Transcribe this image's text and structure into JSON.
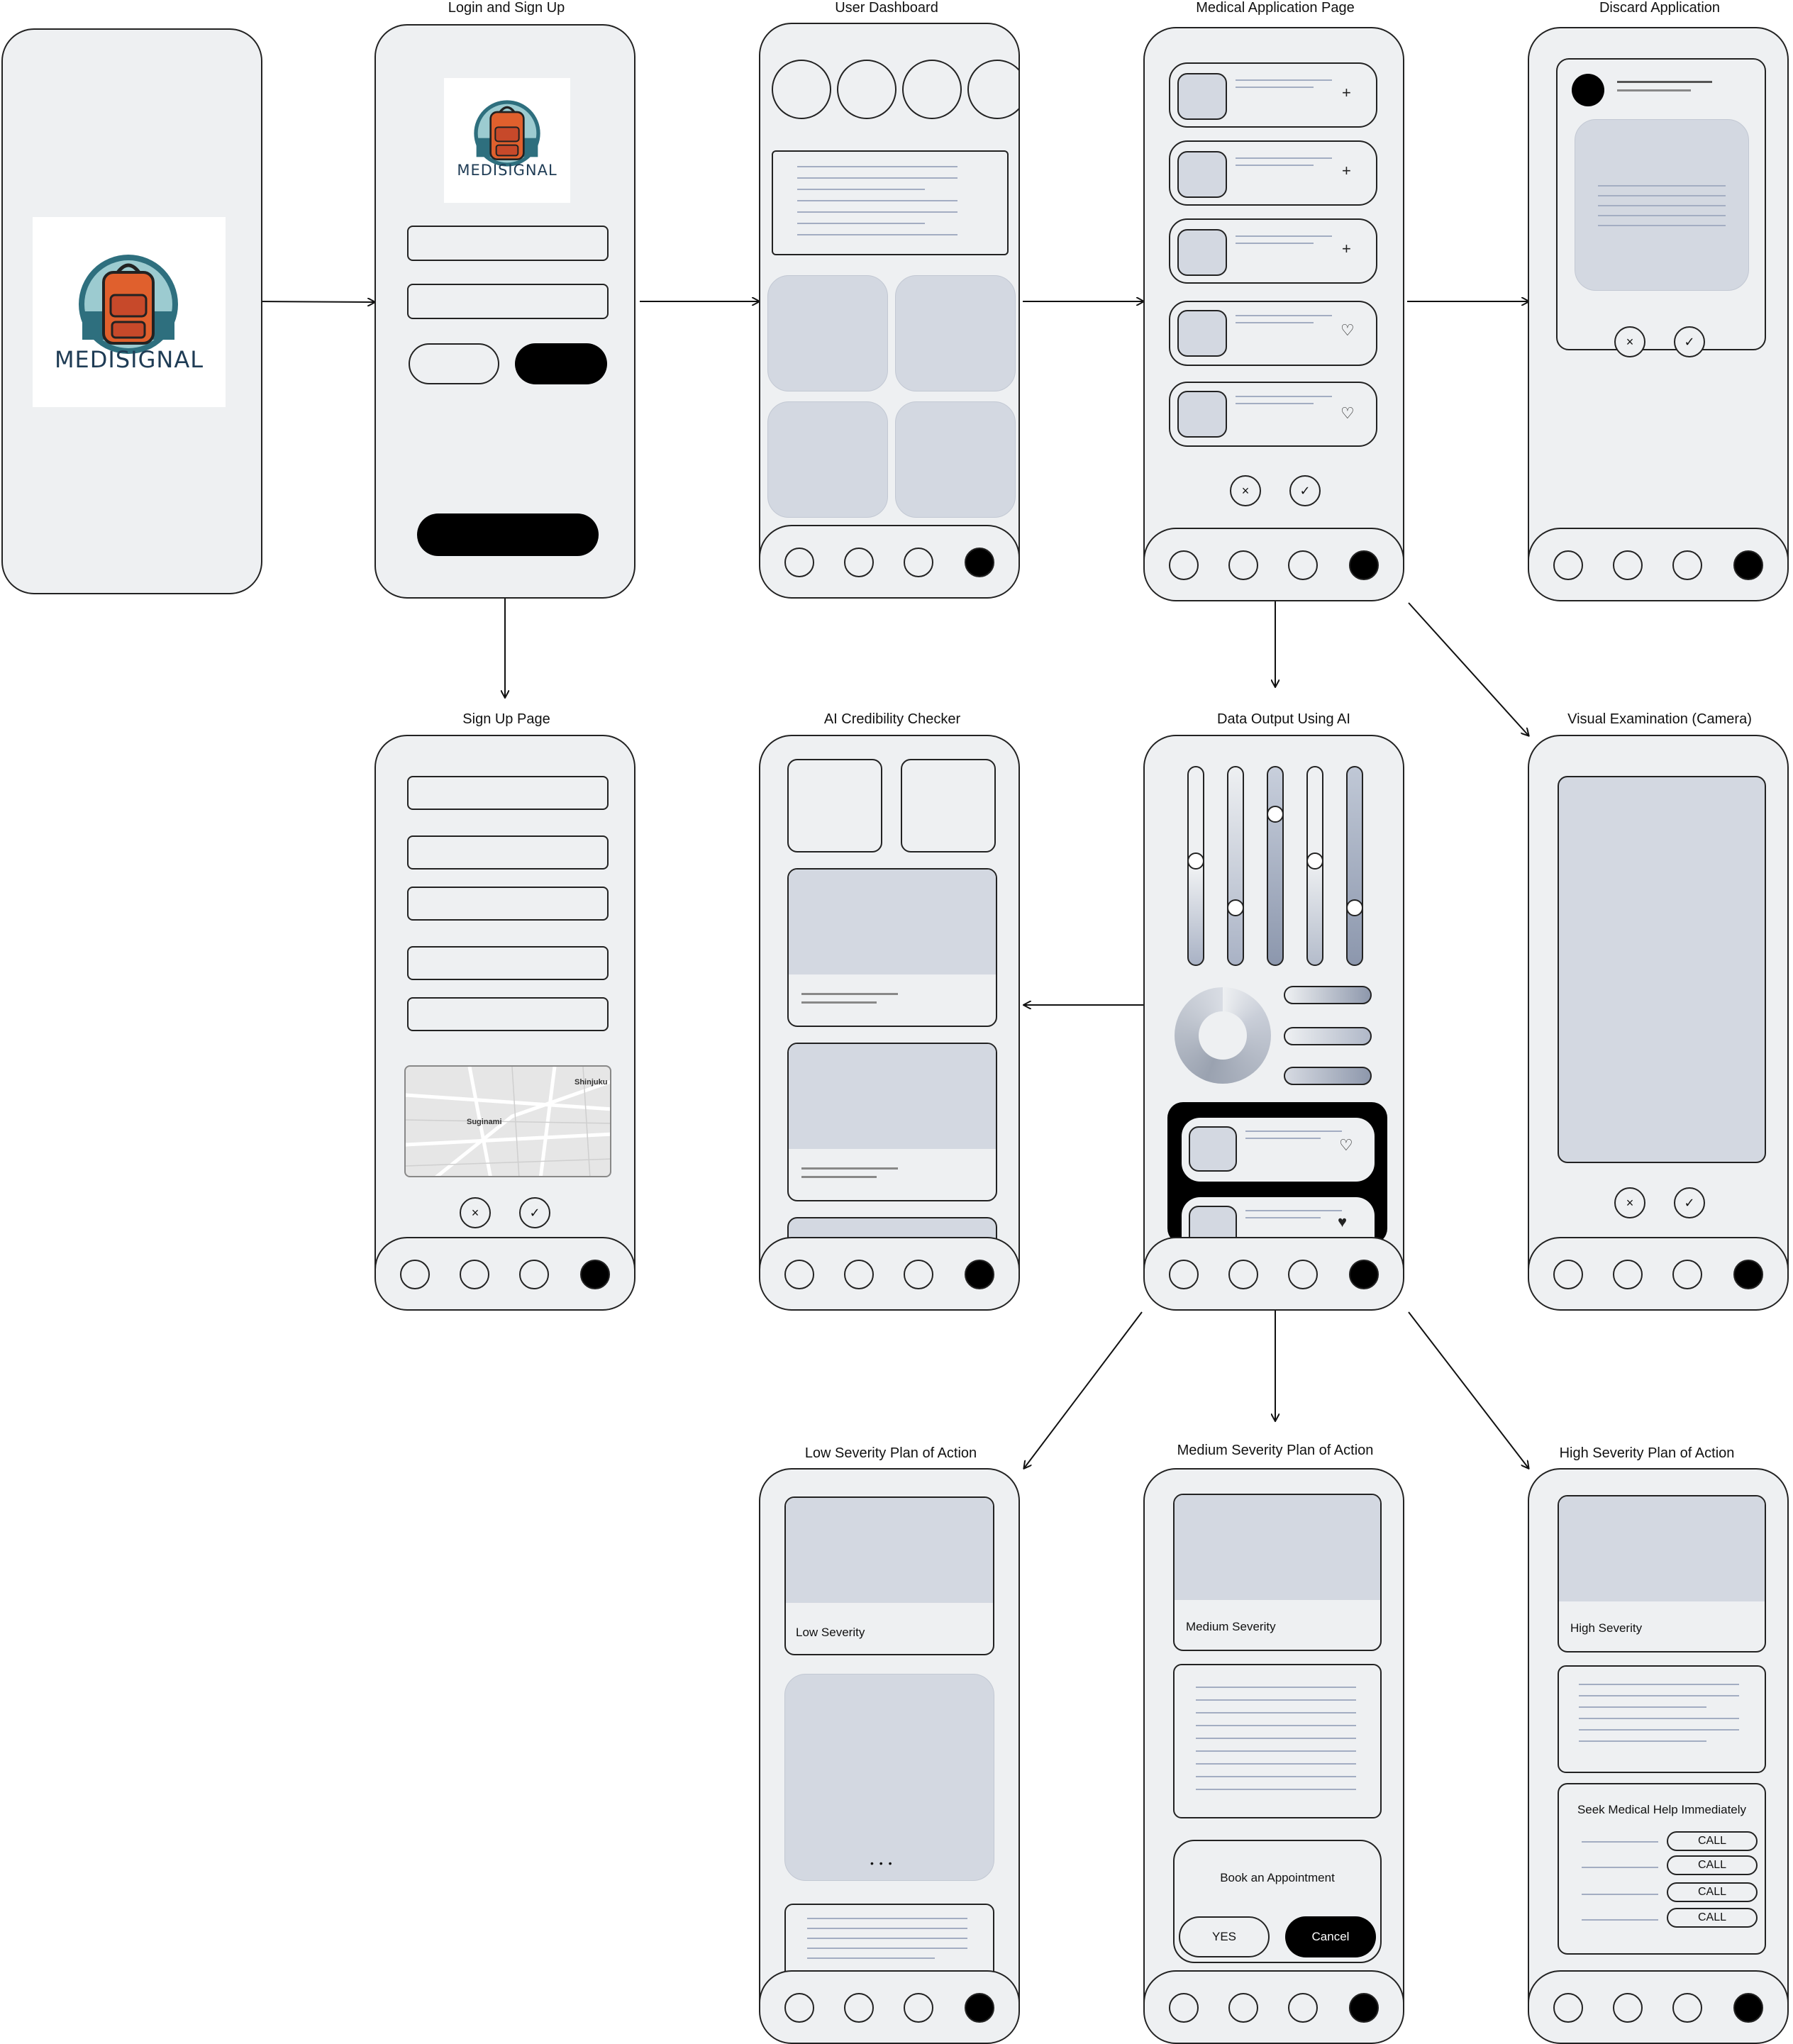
{
  "screens": {
    "splash": {
      "title": "",
      "logo": "MEDISIGNAL"
    },
    "login": {
      "title": "Login and Sign Up",
      "logo": "MEDISIGNAL"
    },
    "dashboard": {
      "title": "User Dashboard"
    },
    "medical": {
      "title": "Medical Application Page"
    },
    "discard": {
      "title": "Discard Application"
    },
    "signup": {
      "title": "Sign Up Page",
      "map_labels": [
        "Shinjuku",
        "Suginami"
      ]
    },
    "credibility": {
      "title": "AI Credibility Checker"
    },
    "output": {
      "title": "Data Output Using AI"
    },
    "camera": {
      "title": "Visual Examination (Camera)"
    },
    "low": {
      "title": "Low Severity Plan of Action",
      "card_label": "Low Severity",
      "dots": "• • •"
    },
    "medium": {
      "title": "Medium Severity Plan of Action",
      "card_label": "Medium Severity",
      "prompt": "Book an Appointment",
      "yes": "YES",
      "cancel": "Cancel"
    },
    "high": {
      "title": "High Severity Plan of Action",
      "card_label": "High Severity",
      "alert": "Seek Medical Help Immediately",
      "call": "CALL"
    }
  },
  "icons": {
    "plus": "+",
    "heart": "♡",
    "heart_filled": "♥",
    "close": "×",
    "check": "✓"
  },
  "colors": {
    "screen_bg": "#eef0f2",
    "placeholder": "#d3d8e1",
    "line": "#a3adc2",
    "dark": "#000000"
  }
}
